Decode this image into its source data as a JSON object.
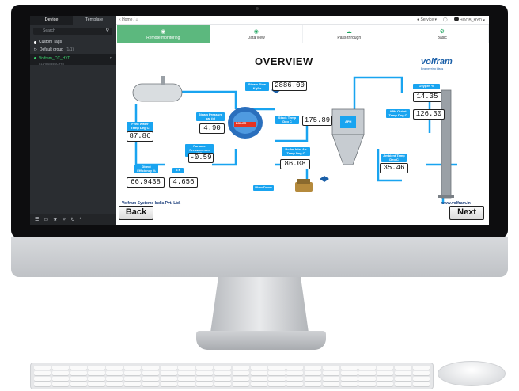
{
  "sidebar": {
    "tabs": [
      "Device",
      "Template"
    ],
    "search_placeholder": "Search",
    "items": [
      {
        "label": "Custom Tags"
      },
      {
        "label": "Default group",
        "count": "(1/1)"
      }
    ],
    "device": {
      "name": "Volfram_CC_HYD",
      "sub": "C11H5A0B50A-HYD"
    }
  },
  "topbar": {
    "breadcrumb": "Home",
    "service": "Service",
    "user": "HOOB_HYD"
  },
  "nav_tabs": [
    {
      "label": "Remote monitoring",
      "icon": "camera-icon",
      "active": true
    },
    {
      "label": "Data view",
      "icon": "camera-icon",
      "active": false
    },
    {
      "label": "Pass-through",
      "icon": "cloud-icon",
      "active": false
    },
    {
      "label": "Basic",
      "icon": "gear-icon",
      "active": false
    }
  ],
  "diagram": {
    "title": "OVERVIEW",
    "brand": "volfram",
    "brand_sub": "Engineering Ideas",
    "company": "Volfram Systems India Pvt. Ltd.",
    "website": "www.volfram.in",
    "back_label": "Back",
    "next_label": "Next",
    "boiler_label": "BOILER",
    "aph_label": "APH",
    "readings": {
      "steam_flow": {
        "label": "Steam Flow Kg/hr",
        "value": "2886.00"
      },
      "oxygen": {
        "label": "Oxygen %",
        "value": "14.35"
      },
      "steam_pressure": {
        "label": "Steam Pressure bar (g)",
        "value": "4.90"
      },
      "stack_temp": {
        "label": "Stack Temp Deg C",
        "value": "175.89"
      },
      "aph_outlet": {
        "label": "APH Outlet Temp Deg C",
        "value": "126.30"
      },
      "feed_water": {
        "label": "Feed Water Temp Deg C",
        "value": "87.86"
      },
      "furnace_pressure": {
        "label": "Furnace Pressure mm WC",
        "value": "-0.59"
      },
      "boiler_inlet": {
        "label": "Boiler Inlet Air Temp Deg C",
        "value": "86.08"
      },
      "ambient": {
        "label": "Ambient Temp Deg C",
        "value": "35.46"
      },
      "direct_eff": {
        "label": "Direct Efficiency %",
        "value": "66.9438"
      },
      "sf": {
        "label": "S:F",
        "value": "4.656"
      },
      "blow_down": {
        "label": "Blow Down"
      }
    }
  }
}
